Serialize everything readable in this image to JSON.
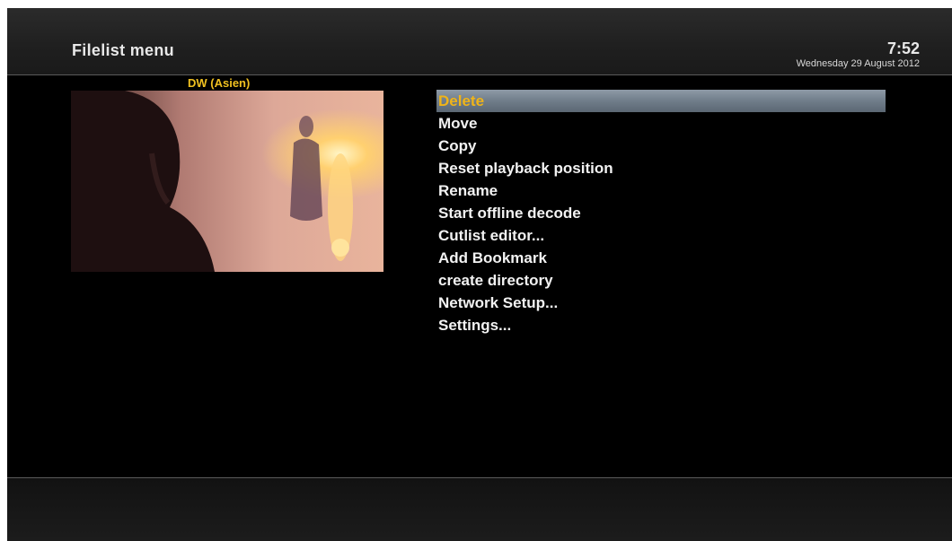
{
  "header": {
    "title": "Filelist menu",
    "time": "7:52",
    "date": "Wednesday 29 August 2012"
  },
  "preview": {
    "channel": "DW (Asien)"
  },
  "menu": {
    "selected_index": 0,
    "items": [
      {
        "label": "Delete"
      },
      {
        "label": "Move"
      },
      {
        "label": "Copy"
      },
      {
        "label": "Reset playback position"
      },
      {
        "label": "Rename"
      },
      {
        "label": "Start offline decode"
      },
      {
        "label": "Cutlist editor..."
      },
      {
        "label": "Add Bookmark"
      },
      {
        "label": "create directory"
      },
      {
        "label": "Network Setup..."
      },
      {
        "label": "Settings..."
      }
    ]
  },
  "colors": {
    "selected_text": "#f0b418",
    "channel_text": "#f0c020",
    "menu_text": "#f2f2f2"
  }
}
